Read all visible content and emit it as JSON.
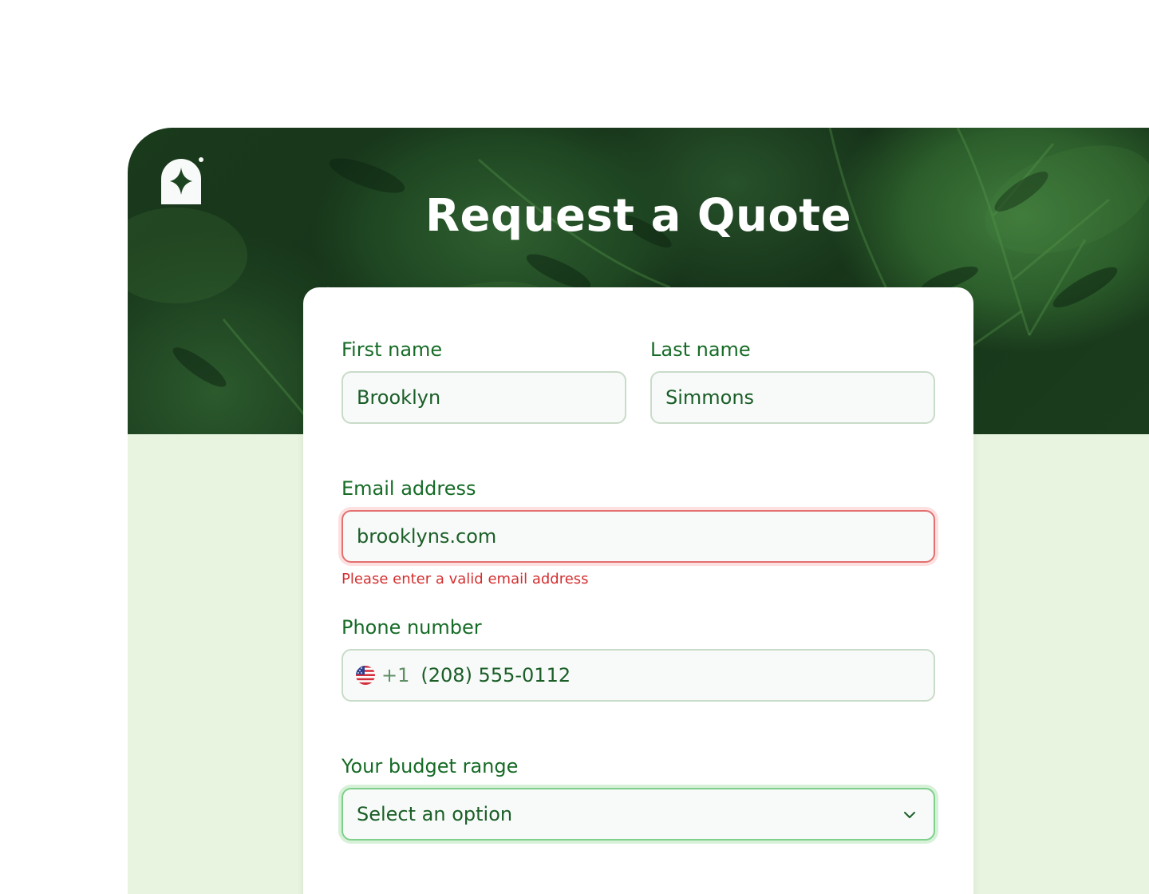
{
  "header": {
    "title": "Request a Quote",
    "logo_icon": "sparkle-house-icon"
  },
  "form": {
    "first_name": {
      "label": "First name",
      "value": "Brooklyn"
    },
    "last_name": {
      "label": "Last name",
      "value": "Simmons"
    },
    "email": {
      "label": "Email address",
      "value": "brooklyns.com",
      "error": "Please enter a valid email address"
    },
    "phone": {
      "label": "Phone number",
      "flag_icon": "us-flag-icon",
      "dial_code": "+1",
      "value": "(208) 555-0112"
    },
    "budget": {
      "label": "Your budget range",
      "placeholder": "Select an option",
      "chevron_icon": "chevron-down-icon"
    }
  },
  "colors": {
    "label": "#166b26",
    "input_text": "#1b5e28",
    "error": "#d42f2f",
    "page_bg": "#e8f3e0",
    "focus": "#7ed08a"
  }
}
